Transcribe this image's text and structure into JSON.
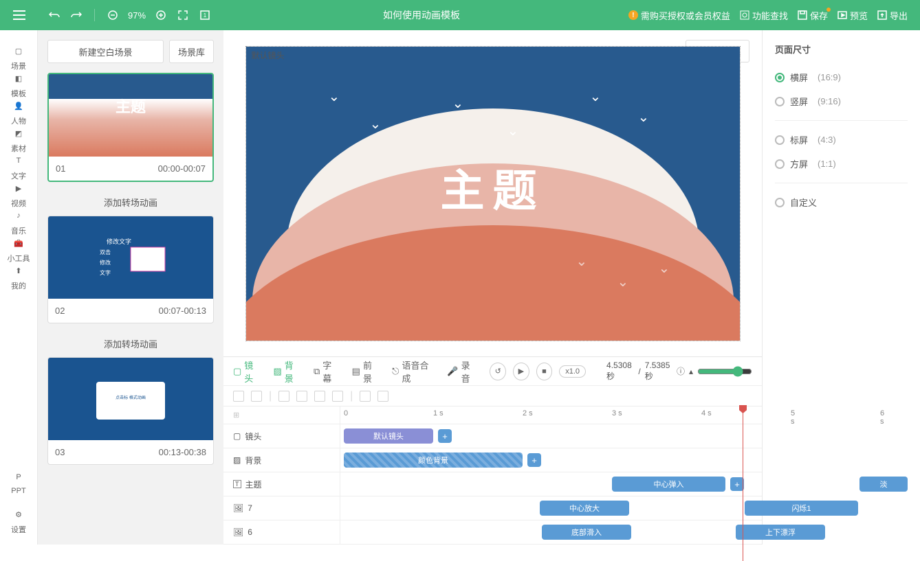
{
  "topbar": {
    "zoom": "97%",
    "doc_title": "如何使用动画模板",
    "buy_license": "需购买授权或会员权益",
    "feature_search": "功能查找",
    "save": "保存",
    "preview": "预览",
    "export": "导出"
  },
  "rail": [
    {
      "label": "场景"
    },
    {
      "label": "模板"
    },
    {
      "label": "人物"
    },
    {
      "label": "素材"
    },
    {
      "label": "文字"
    },
    {
      "label": "视频"
    },
    {
      "label": "音乐"
    },
    {
      "label": "小工具"
    },
    {
      "label": "我的"
    }
  ],
  "rail_bottom": [
    {
      "label": "PPT"
    },
    {
      "label": "设置"
    }
  ],
  "scenes": {
    "new_blank": "新建空白场景",
    "library": "场景库",
    "add_transition": "添加转场动画",
    "items": [
      {
        "index": "01",
        "time": "00:00-00:07"
      },
      {
        "index": "02",
        "time": "00:07-00:13"
      },
      {
        "index": "03",
        "time": "00:13-00:38"
      }
    ]
  },
  "canvas": {
    "bg_music": "背景音乐",
    "default_camera": "默认镜头",
    "title_text": "主题"
  },
  "timeline": {
    "tabs": {
      "camera": "镜头",
      "background": "背景",
      "subtitle": "字幕",
      "foreground": "前景",
      "tts": "语音合成",
      "record": "录音"
    },
    "speed": "x1.0",
    "current_time": "4.5308 秒",
    "total_time": "7.5385 秒",
    "seconds_unit": "s",
    "ticks": [
      "0",
      "1 s",
      "2 s",
      "3 s",
      "4 s",
      "5 s",
      "6 s"
    ],
    "rows": [
      {
        "label": "镜头",
        "icon": "camera"
      },
      {
        "label": "背景",
        "icon": "bg"
      },
      {
        "label": "主题",
        "icon": "text"
      },
      {
        "label": "7",
        "icon": "img"
      },
      {
        "label": "6",
        "icon": "img"
      }
    ],
    "clips": {
      "default_camera": "默认镜头",
      "color_bg": "颜色背景",
      "center_bounce": "中心弹入",
      "center_zoom": "中心放大",
      "flash1": "闪烁1",
      "bottom_slide": "底部滑入",
      "float_updown": "上下漂浮",
      "fade": "淡"
    }
  },
  "right_panel": {
    "title": "页面尺寸",
    "options": [
      {
        "label": "横屏",
        "ratio": "(16:9)",
        "checked": true
      },
      {
        "label": "竖屏",
        "ratio": "(9:16)"
      },
      {
        "label": "标屏",
        "ratio": "(4:3)"
      },
      {
        "label": "方屏",
        "ratio": "(1:1)"
      },
      {
        "label": "自定义",
        "ratio": ""
      }
    ]
  }
}
